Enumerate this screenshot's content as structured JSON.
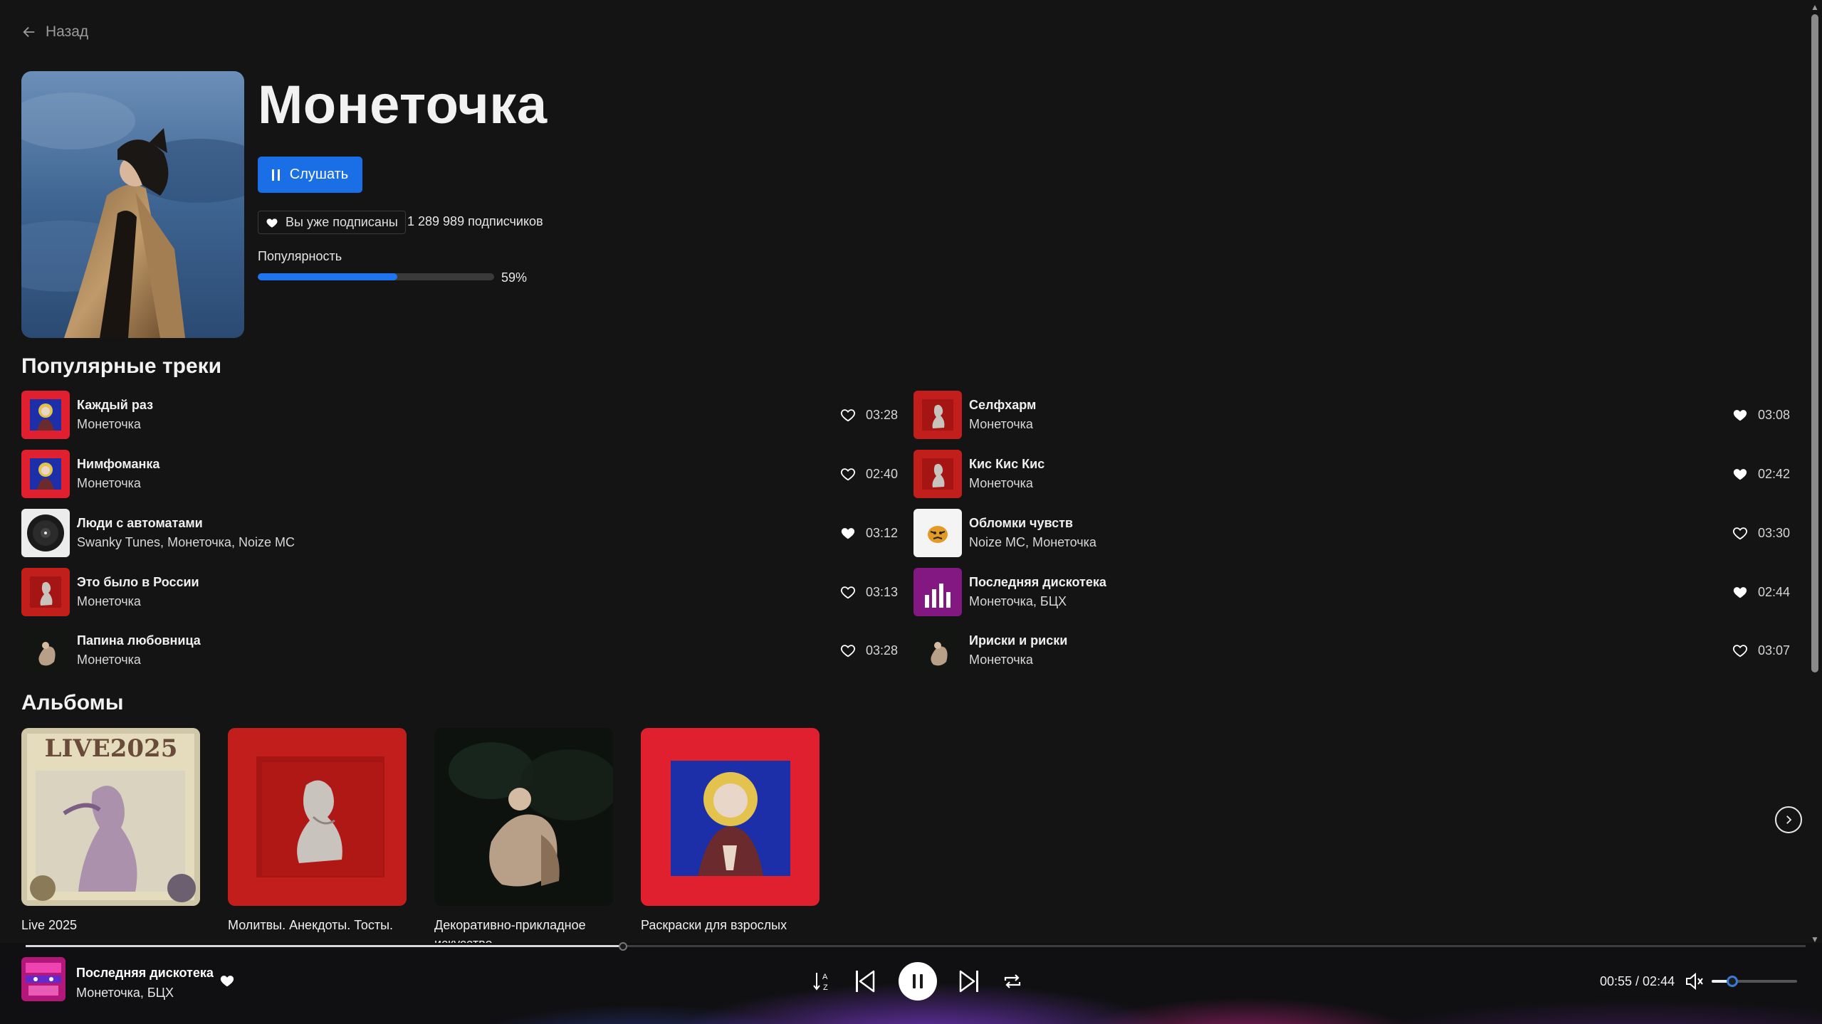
{
  "nav": {
    "back_label": "Назад"
  },
  "artist": {
    "name": "Монеточка",
    "listen_label": "Слушать",
    "subscribed_label": "Вы уже подписаны",
    "subscribers": "1 289 989 подписчиков",
    "popularity_label": "Популярность",
    "popularity_value": "59%",
    "popularity_fraction": 0.59
  },
  "popular": {
    "title": "Популярные треки",
    "left": [
      {
        "title": "Каждый раз",
        "artist": "Монеточка",
        "duration": "03:28",
        "liked": false,
        "art": "icon-blue"
      },
      {
        "title": "Нимфоманка",
        "artist": "Монеточка",
        "duration": "02:40",
        "liked": false,
        "art": "icon-blue"
      },
      {
        "title": "Люди с автоматами",
        "artist": "Swanky Tunes, Монеточка, Noize MC",
        "duration": "03:12",
        "liked": true,
        "art": "vinyl"
      },
      {
        "title": "Это было в России",
        "artist": "Монеточка",
        "duration": "03:13",
        "liked": false,
        "art": "red-figure"
      },
      {
        "title": "Папина любовница",
        "artist": "Монеточка",
        "duration": "03:28",
        "liked": false,
        "art": "dark-figure"
      }
    ],
    "right": [
      {
        "title": "Селфхарм",
        "artist": "Монеточка",
        "duration": "03:08",
        "liked": true,
        "art": "red-figure"
      },
      {
        "title": "Кис Кис Кис",
        "artist": "Монеточка",
        "duration": "02:42",
        "liked": true,
        "art": "red-figure"
      },
      {
        "title": "Обломки чувств",
        "artist": "Noize MC, Монеточка",
        "duration": "03:30",
        "liked": false,
        "art": "tiger"
      },
      {
        "title": "Последняя дискотека",
        "artist": "Монеточка, БЦХ",
        "duration": "02:44",
        "liked": true,
        "art": "purple-eq"
      },
      {
        "title": "Ириски и риски",
        "artist": "Монеточка",
        "duration": "03:07",
        "liked": false,
        "art": "dark-figure"
      }
    ]
  },
  "albums": {
    "title": "Альбомы",
    "items": [
      {
        "name": "Live 2025",
        "cover_text": "LIVE2025"
      },
      {
        "name": "Молитвы. Анекдоты. Тосты."
      },
      {
        "name": "Декоративно-прикладное искусство"
      },
      {
        "name": "Раскраски для взрослых"
      }
    ]
  },
  "player": {
    "title": "Последняя дискотека",
    "artist": "Монеточка, БЦХ",
    "time": "00:55 / 02:44",
    "progress_fraction": 0.3354,
    "volume_fraction": 0.24,
    "liked": true
  },
  "colors": {
    "accent": "#1a6ee6",
    "background": "#141414",
    "text": "#f0f0f0"
  }
}
